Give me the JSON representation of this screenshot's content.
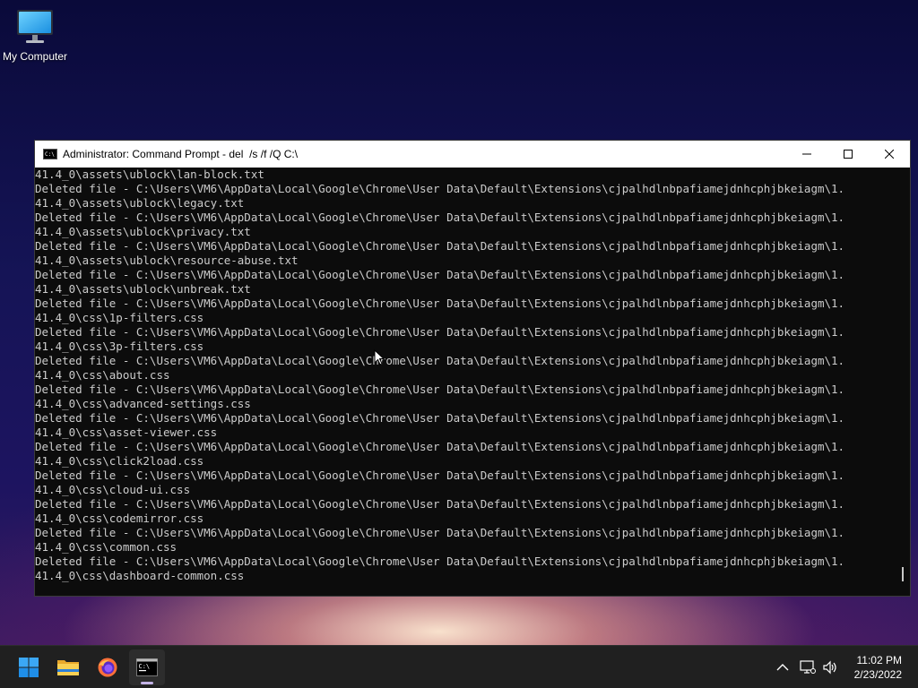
{
  "desktop": {
    "icons": [
      {
        "label": "My Computer",
        "icon": "monitor-icon"
      }
    ]
  },
  "window": {
    "title": "Administrator: Command Prompt - del  /s /f /Q C:\\",
    "controls": [
      "minimize-icon",
      "maximize-icon",
      "close-icon"
    ],
    "console_lines": [
      "41.4_0\\assets\\ublock\\lan-block.txt",
      "Deleted file - C:\\Users\\VM6\\AppData\\Local\\Google\\Chrome\\User Data\\Default\\Extensions\\cjpalhdlnbpafiamejdnhcphjbkeiagm\\1.",
      "41.4_0\\assets\\ublock\\legacy.txt",
      "Deleted file - C:\\Users\\VM6\\AppData\\Local\\Google\\Chrome\\User Data\\Default\\Extensions\\cjpalhdlnbpafiamejdnhcphjbkeiagm\\1.",
      "41.4_0\\assets\\ublock\\privacy.txt",
      "Deleted file - C:\\Users\\VM6\\AppData\\Local\\Google\\Chrome\\User Data\\Default\\Extensions\\cjpalhdlnbpafiamejdnhcphjbkeiagm\\1.",
      "41.4_0\\assets\\ublock\\resource-abuse.txt",
      "Deleted file - C:\\Users\\VM6\\AppData\\Local\\Google\\Chrome\\User Data\\Default\\Extensions\\cjpalhdlnbpafiamejdnhcphjbkeiagm\\1.",
      "41.4_0\\assets\\ublock\\unbreak.txt",
      "Deleted file - C:\\Users\\VM6\\AppData\\Local\\Google\\Chrome\\User Data\\Default\\Extensions\\cjpalhdlnbpafiamejdnhcphjbkeiagm\\1.",
      "41.4_0\\css\\1p-filters.css",
      "Deleted file - C:\\Users\\VM6\\AppData\\Local\\Google\\Chrome\\User Data\\Default\\Extensions\\cjpalhdlnbpafiamejdnhcphjbkeiagm\\1.",
      "41.4_0\\css\\3p-filters.css",
      "Deleted file - C:\\Users\\VM6\\AppData\\Local\\Google\\Chrome\\User Data\\Default\\Extensions\\cjpalhdlnbpafiamejdnhcphjbkeiagm\\1.",
      "41.4_0\\css\\about.css",
      "Deleted file - C:\\Users\\VM6\\AppData\\Local\\Google\\Chrome\\User Data\\Default\\Extensions\\cjpalhdlnbpafiamejdnhcphjbkeiagm\\1.",
      "41.4_0\\css\\advanced-settings.css",
      "Deleted file - C:\\Users\\VM6\\AppData\\Local\\Google\\Chrome\\User Data\\Default\\Extensions\\cjpalhdlnbpafiamejdnhcphjbkeiagm\\1.",
      "41.4_0\\css\\asset-viewer.css",
      "Deleted file - C:\\Users\\VM6\\AppData\\Local\\Google\\Chrome\\User Data\\Default\\Extensions\\cjpalhdlnbpafiamejdnhcphjbkeiagm\\1.",
      "41.4_0\\css\\click2load.css",
      "Deleted file - C:\\Users\\VM6\\AppData\\Local\\Google\\Chrome\\User Data\\Default\\Extensions\\cjpalhdlnbpafiamejdnhcphjbkeiagm\\1.",
      "41.4_0\\css\\cloud-ui.css",
      "Deleted file - C:\\Users\\VM6\\AppData\\Local\\Google\\Chrome\\User Data\\Default\\Extensions\\cjpalhdlnbpafiamejdnhcphjbkeiagm\\1.",
      "41.4_0\\css\\codemirror.css",
      "Deleted file - C:\\Users\\VM6\\AppData\\Local\\Google\\Chrome\\User Data\\Default\\Extensions\\cjpalhdlnbpafiamejdnhcphjbkeiagm\\1.",
      "41.4_0\\css\\common.css",
      "Deleted file - C:\\Users\\VM6\\AppData\\Local\\Google\\Chrome\\User Data\\Default\\Extensions\\cjpalhdlnbpafiamejdnhcphjbkeiagm\\1.",
      "41.4_0\\css\\dashboard-common.css"
    ],
    "colors": {
      "console_bg": "#0c0c0c",
      "console_fg": "#cccccc",
      "titlebar_bg": "#ffffff"
    }
  },
  "taskbar": {
    "apps": [
      {
        "name": "start",
        "icon": "windows-start-icon"
      },
      {
        "name": "file-explorer",
        "icon": "folder-icon"
      },
      {
        "name": "firefox",
        "icon": "firefox-icon"
      },
      {
        "name": "command-prompt",
        "icon": "terminal-icon",
        "active": true
      }
    ],
    "tray": [
      "chevron-up-icon",
      "network-icon",
      "volume-icon"
    ],
    "clock": {
      "time": "11:02 PM",
      "date": "2/23/2022"
    }
  }
}
